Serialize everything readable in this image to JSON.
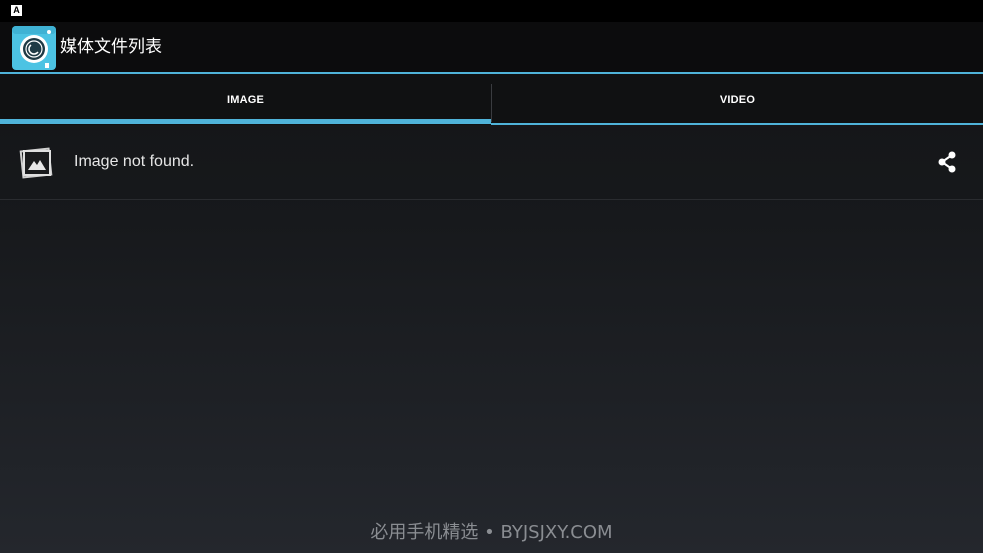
{
  "status_bar": {
    "icon_letter": "A"
  },
  "action_bar": {
    "title": "媒体文件列表",
    "app_icon": "camera-icon"
  },
  "tabs": [
    {
      "label": "IMAGE",
      "selected": true
    },
    {
      "label": "VIDEO",
      "selected": false
    }
  ],
  "list": {
    "items": [
      {
        "label": "Image not found.",
        "icon": "image-placeholder-icon",
        "action_icon": "share-icon"
      }
    ]
  },
  "watermark": "必用手机精选 • BYJSJXY.COM",
  "colors": {
    "accent": "#4fb3d9",
    "action_bar_bg": "#0c0c0d",
    "tab_bar_bg": "#101112"
  }
}
